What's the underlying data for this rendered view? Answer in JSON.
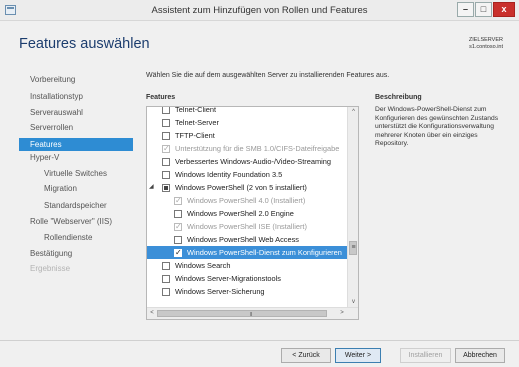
{
  "window": {
    "title": "Assistent zum Hinzufügen von Rollen und Features",
    "minimize_glyph": "–",
    "maximize_glyph": "□",
    "close_glyph": "x"
  },
  "header": {
    "page_title": "Features auswählen",
    "server_label": "ZIELSERVER",
    "server_name": "s1.contoso.int"
  },
  "nav": {
    "items": [
      {
        "label": "Vorbereitung",
        "state": "normal"
      },
      {
        "label": "Installationstyp",
        "state": "normal"
      },
      {
        "label": "Serverauswahl",
        "state": "normal"
      },
      {
        "label": "Serverrollen",
        "state": "normal"
      },
      {
        "label": "Features",
        "state": "active"
      },
      {
        "label": "Hyper-V",
        "state": "normal"
      },
      {
        "label": "Virtuelle Switches",
        "state": "sub"
      },
      {
        "label": "Migration",
        "state": "sub"
      },
      {
        "label": "Standardspeicher",
        "state": "sub"
      },
      {
        "label": "Rolle \"Webserver\" (IIS)",
        "state": "normal"
      },
      {
        "label": "Rollendienste",
        "state": "sub"
      },
      {
        "label": "Bestätigung",
        "state": "normal"
      },
      {
        "label": "Ergebnisse",
        "state": "disabled"
      }
    ]
  },
  "main": {
    "intro": "Wählen Sie die auf dem ausgewählten Server zu installierenden Features aus.",
    "features_header": "Features",
    "description_header": "Beschreibung",
    "description_text": "Der Windows-PowerShell-Dienst zum Konfigurieren des gewünschten Zustands unterstützt die Konfigurationsverwaltung mehrerer Knoten über ein einziges Repository."
  },
  "features": [
    {
      "label": "Telnet-Client",
      "checked": false,
      "level": 0
    },
    {
      "label": "Telnet-Server",
      "checked": false,
      "level": 0
    },
    {
      "label": "TFTP-Client",
      "checked": false,
      "level": 0
    },
    {
      "label": "Unterstützung für die SMB 1.0/CIFS-Dateifreigabe",
      "checked": true,
      "dim": true,
      "level": 0
    },
    {
      "label": "Verbessertes Windows-Audio-/Video-Streaming",
      "checked": false,
      "level": 0
    },
    {
      "label": "Windows Identity Foundation 3.5",
      "checked": false,
      "level": 0
    },
    {
      "label": "Windows PowerShell (2 von 5 installiert)",
      "checked": "partial",
      "level": 0,
      "expanded": true
    },
    {
      "label": "Windows PowerShell 4.0 (Installiert)",
      "checked": true,
      "dim": true,
      "level": 1
    },
    {
      "label": "Windows PowerShell 2.0 Engine",
      "checked": false,
      "level": 1
    },
    {
      "label": "Windows PowerShell ISE (Installiert)",
      "checked": true,
      "dim": true,
      "level": 1
    },
    {
      "label": "Windows PowerShell Web Access",
      "checked": false,
      "level": 1
    },
    {
      "label": "Windows PowerShell-Dienst zum Konfigurieren",
      "checked": true,
      "level": 1,
      "selected": true
    },
    {
      "label": "Windows Search",
      "checked": false,
      "level": 0
    },
    {
      "label": "Windows Server-Migrationstools",
      "checked": false,
      "level": 0
    },
    {
      "label": "Windows Server-Sicherung",
      "checked": false,
      "level": 0
    }
  ],
  "scrollbars": {
    "up_glyph": "^",
    "down_glyph": "v",
    "left_glyph": "<",
    "right_glyph": ">",
    "grip_glyph": "III",
    "vgrip_glyph": "≡"
  },
  "footer": {
    "back": "< Zurück",
    "next": "Weiter >",
    "install": "Installieren",
    "cancel": "Abbrechen"
  },
  "colors": {
    "accent": "#2e8cd3",
    "selection": "#3b8fd8",
    "title_text": "#1c3d6e",
    "close_button": "#c9302c"
  }
}
